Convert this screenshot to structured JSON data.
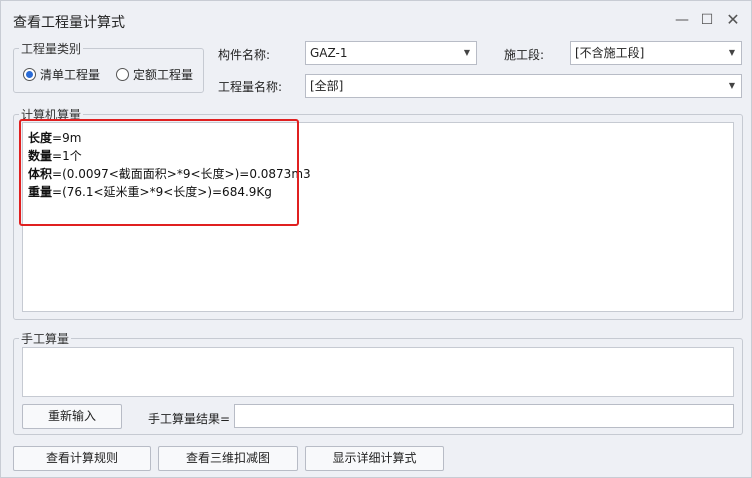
{
  "window": {
    "title": "查看工程量计算式",
    "min_glyph": "—",
    "max_glyph": "☐",
    "close_glyph": "✕"
  },
  "category": {
    "legend": "工程量类别",
    "options": [
      {
        "label": "清单工程量",
        "checked": true
      },
      {
        "label": "定额工程量",
        "checked": false
      }
    ]
  },
  "fields": {
    "component_label": "构件名称:",
    "component_value": "GAZ-1",
    "section_label": "施工段:",
    "section_value": "[不含施工段]",
    "quantity_label": "工程量名称:",
    "quantity_value": "[全部]"
  },
  "computer_calc": {
    "legend": "计算机算量",
    "lines": [
      {
        "key": "长度",
        "expr": "=9m"
      },
      {
        "key": "数量",
        "expr": "=1个"
      },
      {
        "key": "体积",
        "expr": "=(0.0097<截面面积>*9<长度>)=0.0873m3"
      },
      {
        "key": "重量",
        "expr": "=(76.1<延米重>*9<长度>)=684.9Kg"
      }
    ]
  },
  "manual_calc": {
    "legend": "手工算量",
    "reenter_label": "重新输入",
    "result_label": "手工算量结果="
  },
  "footer": {
    "rules_label": "查看计算规则",
    "view3d_label": "查看三维扣减图",
    "detail_label": "显示详细计算式"
  }
}
